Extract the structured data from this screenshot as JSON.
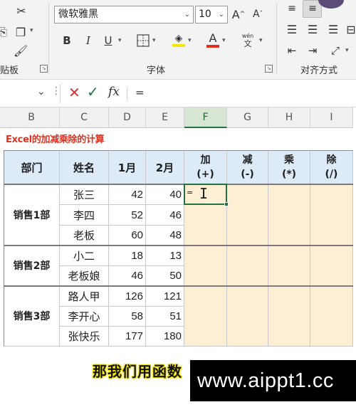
{
  "ribbon": {
    "clipboard_label": "贴板",
    "font_label": "字体",
    "alignment_label": "对齐方式",
    "font_name": "微软雅黑",
    "font_size": "10",
    "wen_label": "wén",
    "wen_char": "文",
    "bold": "B",
    "italic": "I",
    "underline": "U",
    "grow_font": "A^",
    "shrink_font": "Aˇ",
    "font_color_letter": "A",
    "accent_colors": {
      "highlight": "#f6e600",
      "font_color": "#e0301e"
    }
  },
  "formula_bar": {
    "fx_label": "fx",
    "content": "="
  },
  "columns": [
    "B",
    "C",
    "D",
    "E",
    "F",
    "G",
    "H",
    "I"
  ],
  "sheet": {
    "title": "Excel的加减乘除的计算",
    "headers": {
      "dept": "部门",
      "name": "姓名",
      "m1": "1月",
      "m2": "2月",
      "add": [
        "加",
        "(+)"
      ],
      "sub": [
        "减",
        "(-)"
      ],
      "mul": [
        "乘",
        "(*)"
      ],
      "div": [
        "除",
        "(/)"
      ]
    },
    "departments": [
      "销售1部",
      "销售2部",
      "销售3部"
    ],
    "rows": [
      {
        "name": "张三",
        "m1": "42",
        "m2": "40"
      },
      {
        "name": "李四",
        "m1": "52",
        "m2": "46"
      },
      {
        "name": "老板",
        "m1": "60",
        "m2": "48"
      },
      {
        "name": "小二",
        "m1": "18",
        "m2": "13"
      },
      {
        "name": "老板娘",
        "m1": "46",
        "m2": "50"
      },
      {
        "name": "路人甲",
        "m1": "126",
        "m2": "121"
      },
      {
        "name": "李开心",
        "m1": "58",
        "m2": "51"
      },
      {
        "name": "张快乐",
        "m1": "177",
        "m2": "180"
      }
    ],
    "active_cell_text": "="
  },
  "overlay": {
    "subtitle": "那我们用函数",
    "watermark": "www.aippt1.cc"
  }
}
